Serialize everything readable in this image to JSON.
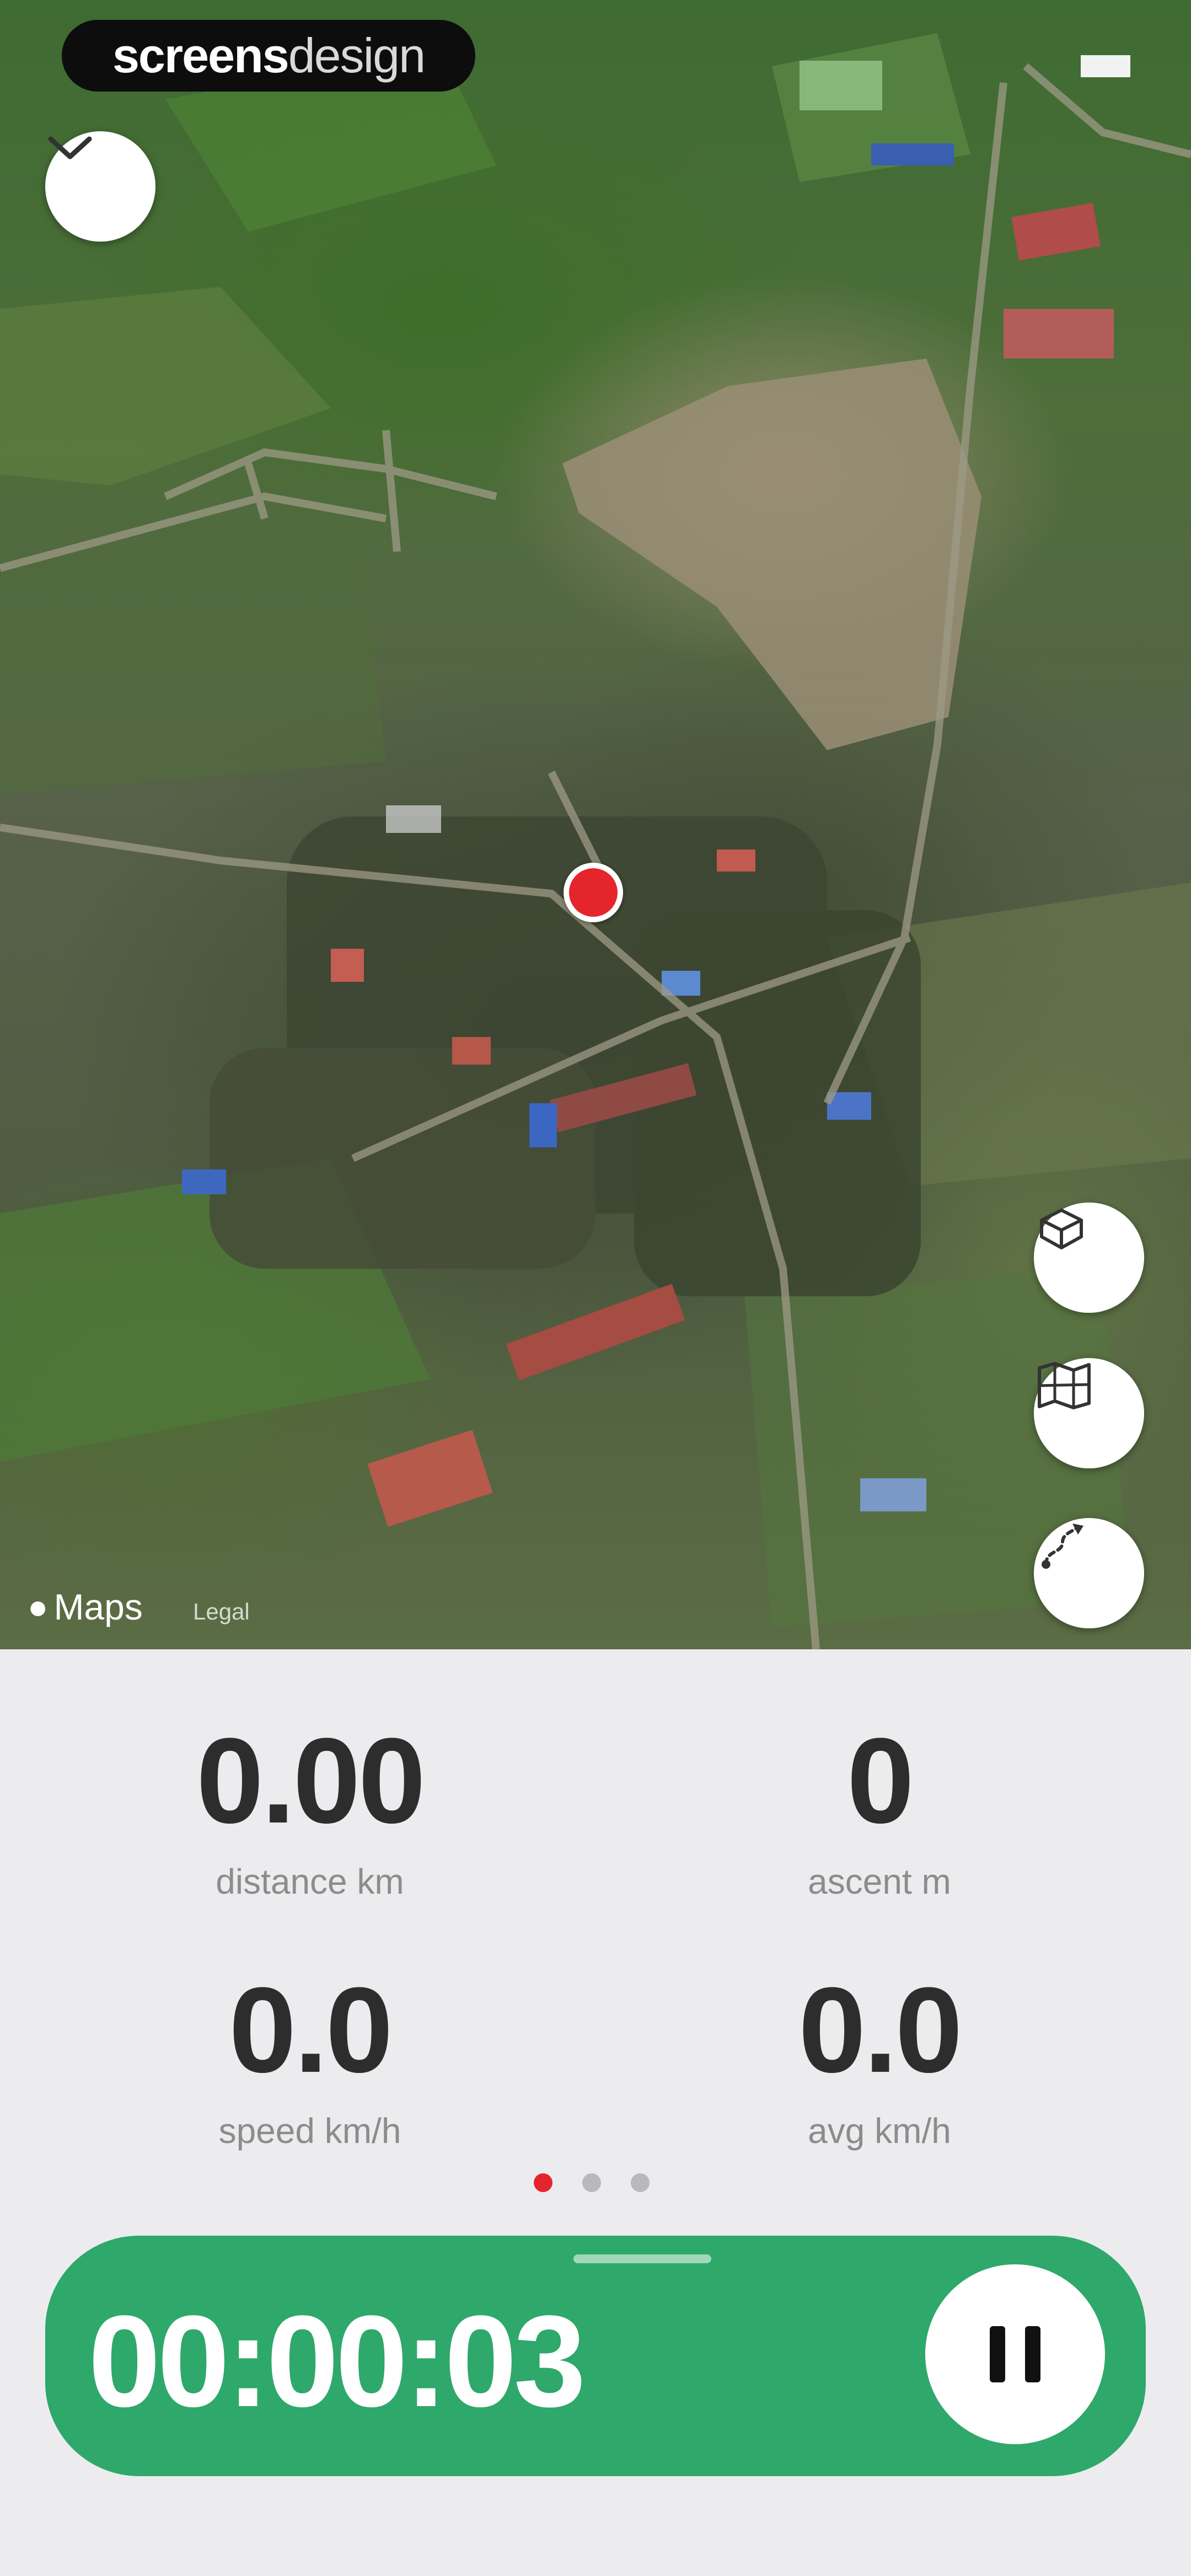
{
  "branding": {
    "logo_bold": "screens",
    "logo_light": "design"
  },
  "map": {
    "attribution": "Maps",
    "legal": "Legal",
    "buttons": {
      "collapse": "chevron-down-icon",
      "layers": "layers-icon",
      "grid": "map-grid-icon",
      "route": "route-icon"
    },
    "user_location_color": "#e5252c"
  },
  "stats": [
    {
      "value": "0.00",
      "label": "distance km"
    },
    {
      "value": "0",
      "label": "ascent m"
    },
    {
      "value": "0.0",
      "label": "speed km/h"
    },
    {
      "value": "0.0",
      "label": "avg km/h"
    }
  ],
  "pager": {
    "pages": 3,
    "active": 1
  },
  "timer": {
    "elapsed": "00:00:03",
    "control": "pause-icon"
  },
  "colors": {
    "accent": "#2ea86b",
    "marker": "#e5252c",
    "text": "#2d2d2d",
    "muted": "#8c8c8c"
  }
}
